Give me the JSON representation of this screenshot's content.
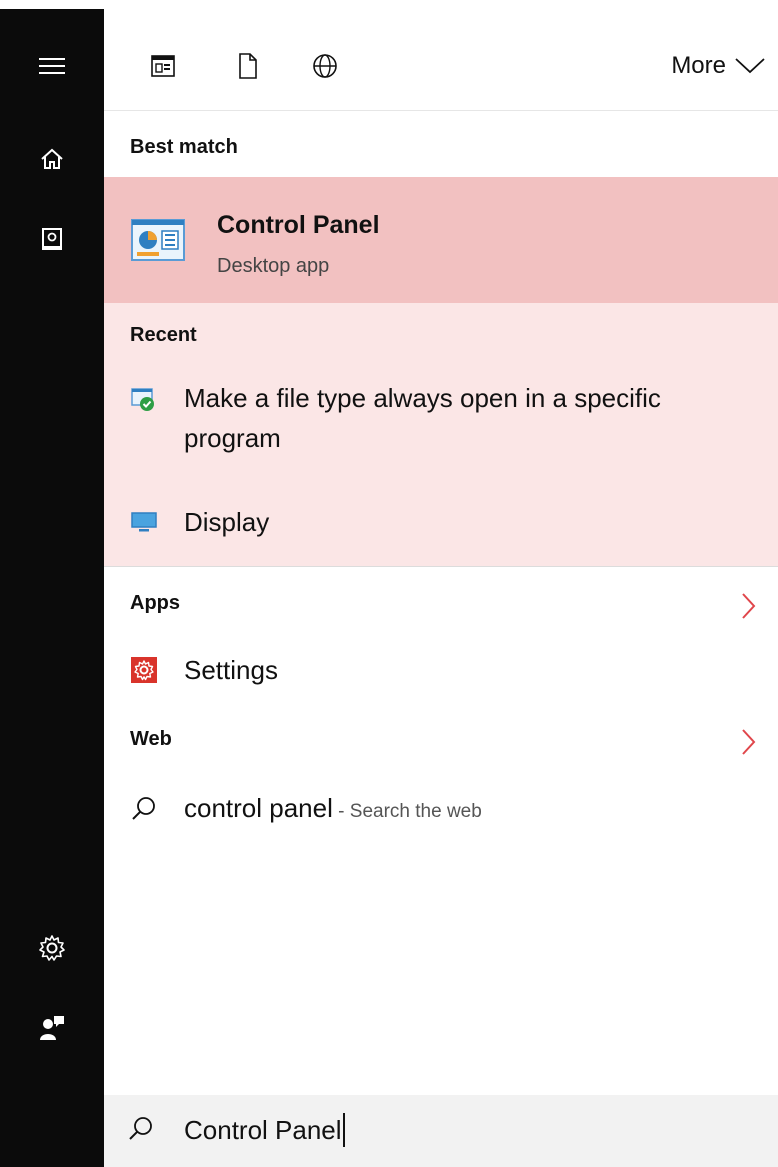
{
  "rail": {
    "menu_icon": "hamburger-icon",
    "home_icon": "home-icon",
    "notebook_icon": "notebook-icon",
    "settings_icon": "gear-icon",
    "feedback_icon": "feedback-icon"
  },
  "filters": {
    "apps_icon": "apps-filter-icon",
    "documents_icon": "document-filter-icon",
    "web_icon": "web-filter-icon",
    "more_label": "More"
  },
  "best_match": {
    "heading": "Best match",
    "title": "Control Panel",
    "subtitle": "Desktop app"
  },
  "recent": {
    "heading": "Recent",
    "items": [
      {
        "label_line1": "Make a file type always open in a specific",
        "label_line2": "program",
        "icon": "default-programs-icon"
      },
      {
        "label": "Display",
        "icon": "display-monitor-icon"
      }
    ]
  },
  "apps": {
    "heading": "Apps",
    "items": [
      {
        "label": "Settings",
        "icon": "settings-gear-icon"
      }
    ]
  },
  "web": {
    "heading": "Web",
    "query": "control panel",
    "suffix": " - Search the web"
  },
  "search": {
    "value": "Control Panel"
  },
  "colors": {
    "best_match_bg": "#f2c1c1",
    "recent_bg": "#fbe6e6",
    "chevron": "#e0464b",
    "rail_bg": "#0b0b0b"
  }
}
